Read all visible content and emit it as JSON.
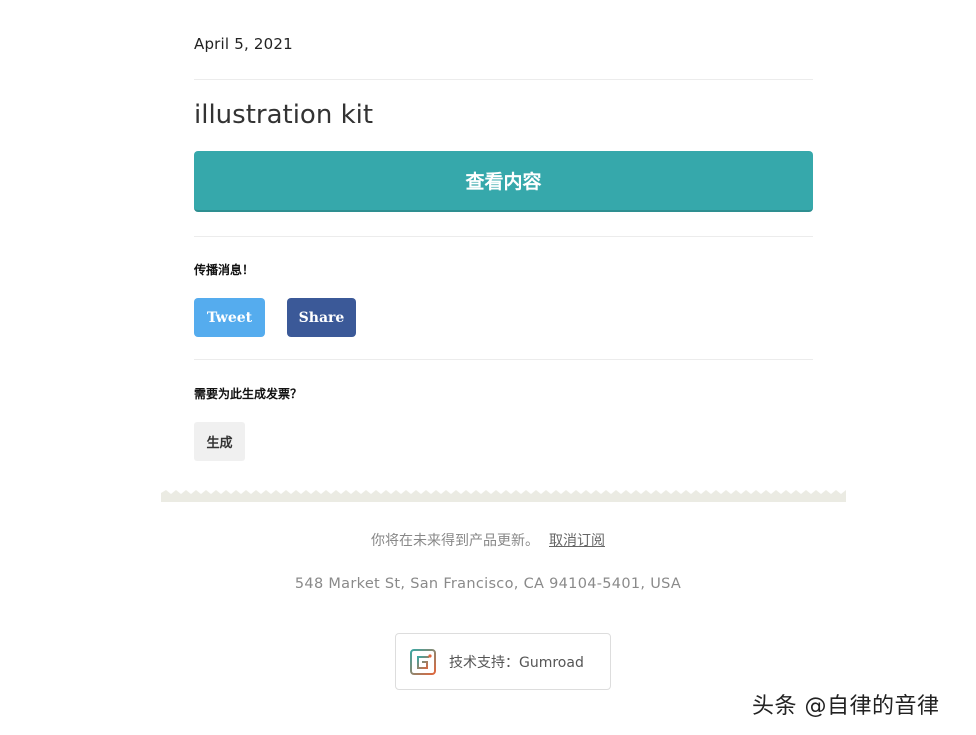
{
  "receipt": {
    "date": "April 5, 2021",
    "product_title": "illustration kit",
    "view_button_label": "查看内容"
  },
  "share_section": {
    "label": "传播消息！",
    "tweet_label": "Tweet",
    "share_label": "Share"
  },
  "invoice_section": {
    "label": "需要为此生成发票？",
    "generate_label": "生成"
  },
  "footer": {
    "updates_text": "你将在未来得到产品更新。",
    "unsubscribe_label": "取消订阅",
    "address": "548 Market St, San Francisco, CA 94104-5401, USA",
    "powered_by": "技术支持：Gumroad"
  },
  "watermark": "头条 @自律的音律",
  "colors": {
    "view_button": "#36a8ab",
    "tweet": "#55acee",
    "share": "#3b5998",
    "divider_zigzag": "#ebebe3"
  },
  "icons": {
    "gumroad_logo": "gumroad-logo-icon"
  }
}
